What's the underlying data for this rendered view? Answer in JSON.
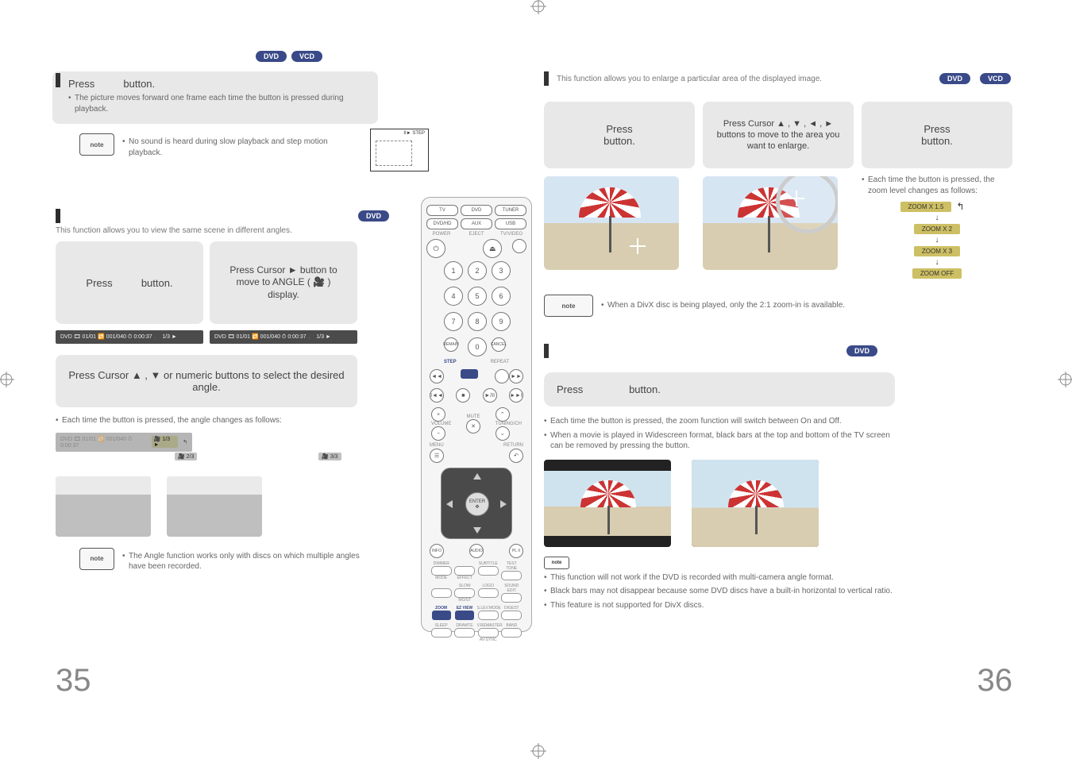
{
  "media_pills": {
    "dvd": "DVD",
    "vcd": "VCD"
  },
  "page_numbers": {
    "left": "35",
    "right": "36"
  },
  "left": {
    "step": {
      "press": "Press",
      "button": "button.",
      "bullet1": "The picture moves forward one frame each time the button is pressed during playback.",
      "note_label": "note",
      "note_text": "No sound is heard during slow playback and step motion playback.",
      "frame_label": "II► STEP"
    },
    "angle": {
      "intro": "This function allows you to view the same scene in different angles.",
      "step1_press": "Press",
      "step1_button": "button.",
      "step2_all": "Press Cursor ► button to move to ANGLE ( 🎥 ) display.",
      "strip_a": "DVD  🎞 01/01  🔁 001/040  ⏱ 0:00:37  🎥 1/3  ►",
      "strip_b": "DVD  🎞 01/01  🔁 001/040  ⏱ 0:00:37  🎥 1/3  ►",
      "numeric": "Press Cursor ▲ , ▼ or numeric buttons to select the desired angle.",
      "each_time": "Each time the button is pressed, the angle changes as follows:",
      "a13": "🎥 1/3  ►",
      "a23": "🎥 2/3",
      "a33": "🎥 3/3",
      "note_label": "note",
      "note_text": "The Angle function works only with discs on which multiple angles have been recorded."
    }
  },
  "remote": {
    "row1": [
      "TV",
      "DVD",
      "TUNER"
    ],
    "row2": [
      "DVD/HD",
      "AUX",
      "USB"
    ],
    "labels_power_row": [
      "POWER",
      "EJECT",
      "TV/VIDEO"
    ],
    "power": "⏻",
    "eject": "⏏",
    "keypad_nums": [
      "1",
      "2",
      "3",
      "4",
      "5",
      "6",
      "7",
      "8",
      "9"
    ],
    "remain": "REMAIN",
    "zero": "0",
    "cancel": "CANCEL",
    "step_label": "STEP",
    "repeat_label": "REPEAT",
    "playback": [
      "◄◄",
      "—",
      "—",
      "►►"
    ],
    "playback2": [
      "I◄◄",
      "■",
      "►/II",
      "►►I"
    ],
    "mute": "MUTE",
    "volume": "VOLUME",
    "tuning": "TUNING/CH",
    "plus": "+",
    "minus": "−",
    "chev_up": "⌃",
    "chev_down": "⌄",
    "menu": "MENU",
    "return": "RETURN",
    "enter_top": "ENTER",
    "enter_bot": "✥",
    "info": "INFO",
    "audio": "AUDIO",
    "pl": "PL II",
    "zoom_row1_labels": [
      "DIMMER",
      "",
      "",
      "TEST TONE"
    ],
    "zoom_row1_main": [
      "MODE",
      "EFFECT",
      "SUBTITLE",
      ""
    ],
    "zoom_row2_labels": [
      "",
      "SLOW",
      "LOGO",
      "SOUND EDIT"
    ],
    "zoom_row2_main": [
      "",
      "MO/ST",
      "",
      ""
    ],
    "zoom_row3_main": [
      "ZOOM",
      "EZ VIEW",
      "S.LEV.MODE",
      "DIGEST"
    ],
    "zoom_row4_labels": [
      "SLEEP",
      "DRAMTE",
      "V.REMASTER",
      "BAND"
    ],
    "zoom_row4_main": [
      "",
      "",
      "AV-SYNC",
      ""
    ]
  },
  "right": {
    "zoom": {
      "intro": "This function allows you to enlarge a particular area of the displayed image.",
      "c1_press": "Press",
      "c1_button": "button.",
      "c2": "Press Cursor ▲ , ▼ , ◄ , ► buttons to move to the area you want to enlarge.",
      "c3_press": "Press",
      "c3_button": "button.",
      "each_time": "Each time the button is pressed, the zoom level changes as follows:",
      "levels": [
        "ZOOM  X 1.5",
        "ZOOM  X 2",
        "ZOOM  X 3",
        "ZOOM  OFF"
      ],
      "loop_arrow": "↰",
      "down": "↓",
      "divx_note_label": "note",
      "divx_note": "When a DivX disc is being played, only the 2:1 zoom-in is available."
    },
    "ezview": {
      "press": "Press",
      "button": "button.",
      "b1": "Each time the button is pressed, the zoom function will switch between On and Off.",
      "b2": "When a movie is played in Widescreen format, black bars at the top and bottom of the TV screen can be removed by pressing the            button.",
      "note_label": "note",
      "n1": "This function will not work if the DVD is recorded with multi-camera angle format.",
      "n2": "Black bars may not disappear because some DVD discs have a built-in horizontal to vertical ratio.",
      "n3": "This feature is not supported for DivX discs."
    }
  }
}
